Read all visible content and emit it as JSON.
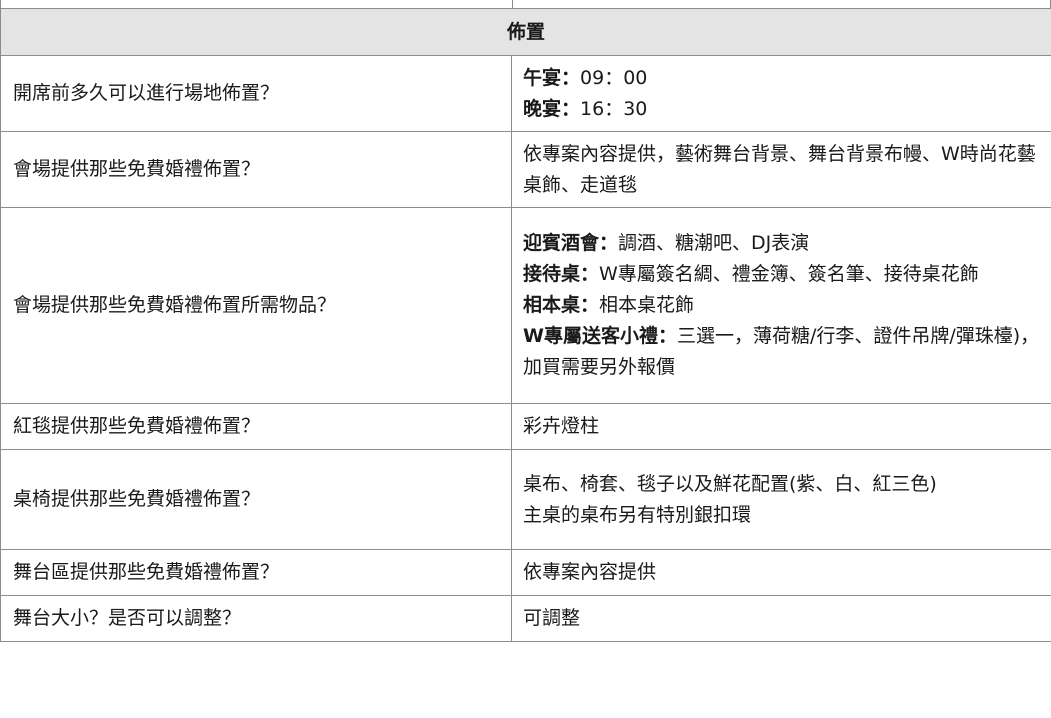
{
  "section_title": "佈置",
  "rows": [
    {
      "question": "開席前多久可以進行場地佈置？",
      "answer_lines": [
        {
          "label": "午宴：",
          "text": "09：00"
        },
        {
          "label": "晚宴：",
          "text": "16：30"
        }
      ]
    },
    {
      "question": "會場提供那些免費婚禮佈置？",
      "answer_lines": [
        {
          "label": "",
          "text": "依專案內容提供，藝術舞台背景、舞台背景布幔、W時尚花藝桌飾、走道毯"
        }
      ]
    },
    {
      "question": "會場提供那些免費婚禮佈置所需物品？",
      "answer_lines": [
        {
          "label": "迎賓酒會：",
          "text": "調酒、糖潮吧、DJ表演"
        },
        {
          "label": "接待桌：",
          "text": "W專屬簽名綢、禮金簿、簽名筆、接待桌花飾"
        },
        {
          "label": "相本桌：",
          "text": "相本桌花飾"
        },
        {
          "label": "W專屬送客小禮：",
          "text": "三選一，薄荷糖/行李、證件吊牌/彈珠檯)，加買需要另外報價"
        }
      ]
    },
    {
      "question": "紅毯提供那些免費婚禮佈置？",
      "answer_lines": [
        {
          "label": "",
          "text": "彩卉燈柱"
        }
      ]
    },
    {
      "question": "桌椅提供那些免費婚禮佈置？",
      "answer_lines": [
        {
          "label": "",
          "text": "桌布、椅套、毯子以及鮮花配置(紫、白、紅三色)"
        },
        {
          "label": "",
          "text": "主桌的桌布另有特別銀扣環"
        }
      ]
    },
    {
      "question": "舞台區提供那些免費婚禮佈置？",
      "answer_lines": [
        {
          "label": "",
          "text": "依專案內容提供"
        }
      ]
    },
    {
      "question": "舞台大小？是否可以調整？",
      "answer_lines": [
        {
          "label": "",
          "text": "可調整"
        }
      ]
    }
  ]
}
